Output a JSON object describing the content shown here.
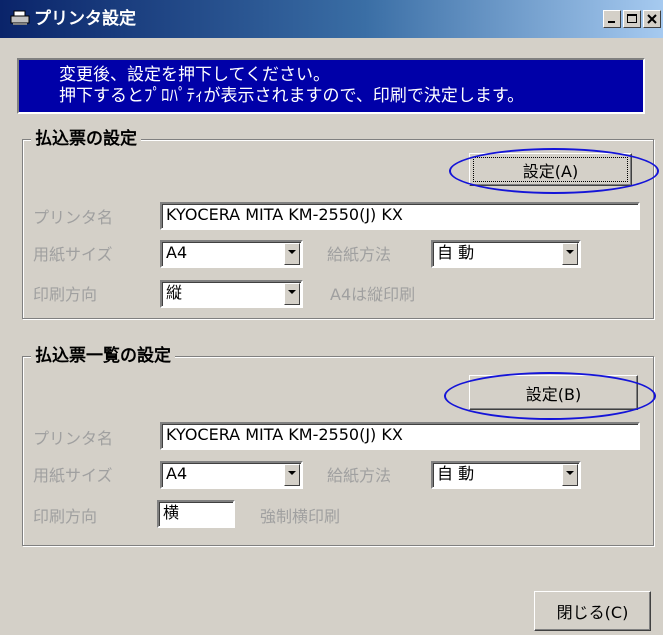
{
  "window": {
    "title": "プリンタ設定"
  },
  "titlebar_buttons": {
    "minimize": "_",
    "maximize": "□",
    "close": "×"
  },
  "banner": {
    "line1": "変更後、設定を押下してください。",
    "line2": "押下するとﾌﾟﾛﾊﾟﾃｨが表示されますので、印刷で決定します。"
  },
  "section1": {
    "title": "払込票の設定",
    "set_button": "設定(A)",
    "printer_label": "プリンタ名",
    "printer_value": "KYOCERA MITA KM-2550(J) KX",
    "paper_size_label": "用紙サイズ",
    "paper_size_value": "A4",
    "feed_label": "給紙方法",
    "feed_value": "自 動",
    "orientation_label": "印刷方向",
    "orientation_value": "縦",
    "orientation_note": "A4は縦印刷"
  },
  "section2": {
    "title": "払込票一覧の設定",
    "set_button": "設定(B)",
    "printer_label": "プリンタ名",
    "printer_value": "KYOCERA MITA KM-2550(J) KX",
    "paper_size_label": "用紙サイズ",
    "paper_size_value": "A4",
    "feed_label": "給紙方法",
    "feed_value": "自 動",
    "orientation_label": "印刷方向",
    "orientation_value": "横",
    "orientation_note": "強制横印刷"
  },
  "close_button": "閉じる(C)",
  "colors": {
    "banner_bg": "#0000a8",
    "window_bg": "#d4d0c8",
    "highlight_ellipse": "#1414d8"
  }
}
